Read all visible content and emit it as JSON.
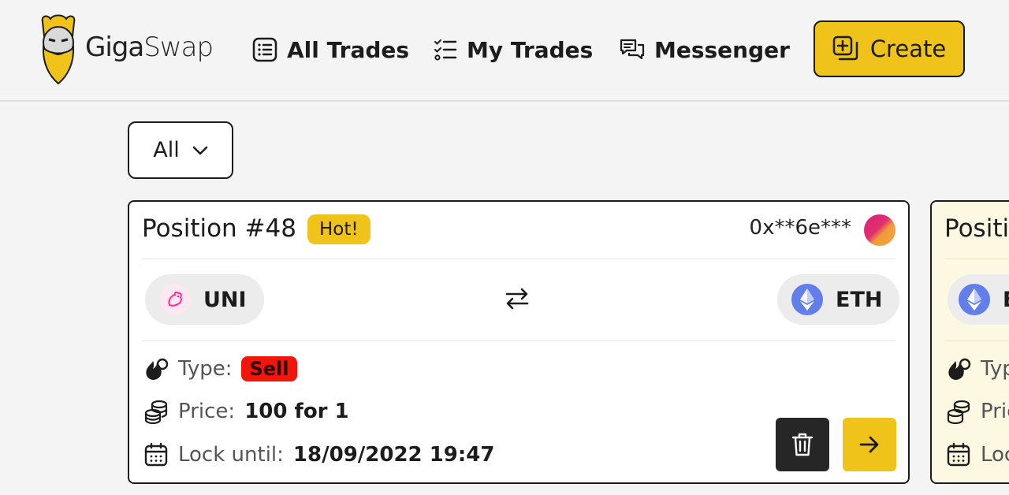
{
  "header": {
    "logo_text_giga": "Giga",
    "logo_text_swap": "Swap",
    "nav": [
      {
        "label": "All Trades",
        "icon": "list-icon"
      },
      {
        "label": "My Trades",
        "icon": "checklist-icon"
      },
      {
        "label": "Messenger",
        "icon": "chat-icon"
      }
    ],
    "create_label": "Create"
  },
  "filter": {
    "selected": "All"
  },
  "cards": [
    {
      "title": "Position #48",
      "badge": "Hot!",
      "owner": "0x**6e***",
      "from_token": "UNI",
      "to_token": "ETH",
      "type_label": "Type:",
      "type_value": "Sell",
      "price_label": "Price:",
      "price_value": "100 for 1",
      "lock_label": "Lock until:",
      "lock_value": "18/09/2022 19:47"
    },
    {
      "title": "Positi",
      "to_token": "E",
      "type_label": "Typ",
      "price_label": "Pric",
      "lock_label": "Loc"
    }
  ],
  "colors": {
    "accent": "#efc319",
    "sell": "#f2150c",
    "background": "#f4f4f4",
    "dark": "#262626"
  }
}
